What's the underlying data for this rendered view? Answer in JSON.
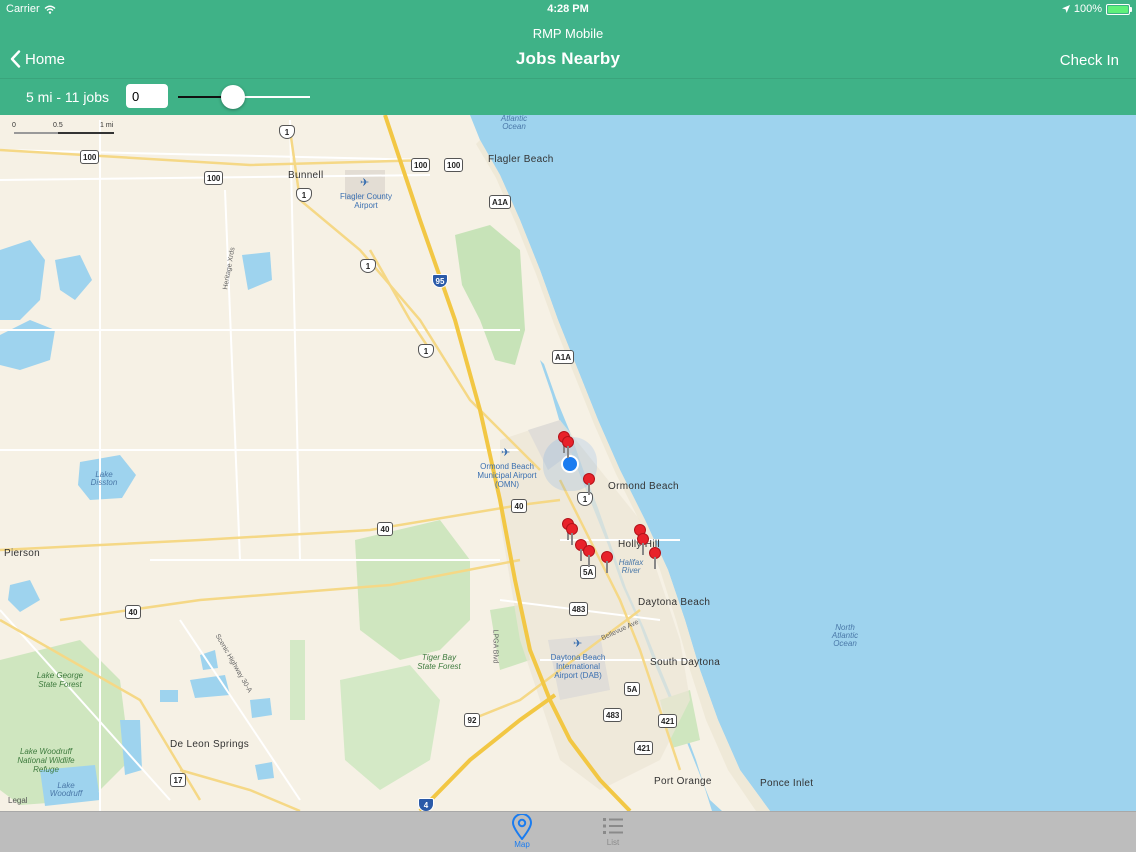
{
  "status_bar": {
    "carrier": "Carrier",
    "time": "4:28 PM",
    "battery": "100%",
    "battery_level": 1.0
  },
  "nav": {
    "subtitle": "RMP Mobile",
    "title": "Jobs Nearby",
    "back_label": "Home",
    "right_label": "Check In"
  },
  "filter": {
    "range_label": "5 mi - 11 jobs",
    "count_value": "0",
    "slider_value": 0.4
  },
  "map": {
    "scale": {
      "zero": "0",
      "half": "0.5",
      "one": "1 mi"
    },
    "cities": {
      "bunnell": "Bunnell",
      "flagler_beach": "Flagler Beach",
      "ormond_beach": "Ormond Beach",
      "holly_hill": "Holly Hill",
      "daytona_beach": "Daytona Beach",
      "south_daytona": "South Daytona",
      "port_orange": "Port Orange",
      "ponce_inlet": "Ponce Inlet",
      "pierson": "Pierson",
      "de_leon_springs": "De Leon Springs"
    },
    "water": {
      "atlantic_ocean_top": "Atlantic Ocean",
      "north_atlantic": "North Atlantic Ocean",
      "lake_disston": "Lake Disston",
      "lake_woodruff": "Lake Woodruff",
      "halifax_river": "Halifax River"
    },
    "parks": {
      "lake_george": "Lake George State Forest",
      "tiger_bay": "Tiger Bay State Forest",
      "woodruff_refuge": "Lake Woodruff National Wildlife Refuge"
    },
    "airports": {
      "flagler": "Flagler County Airport",
      "ormond": "Ormond Beach Municipal Airport (OMN)",
      "daytona": "Daytona Beach International Airport (DAB)"
    },
    "roads": {
      "heritage": "Heritage Xrds",
      "scenic": "Scenic Highway 30-A",
      "bellevue": "Bellevue Ave",
      "lpga": "LPGA Blvd"
    },
    "shields": {
      "us1": "1",
      "sr100": "100",
      "a1a": "A1A",
      "i95": "95",
      "sr40": "40",
      "sr5a": "5A",
      "sr483": "483",
      "sr421": "421",
      "sr92": "92",
      "sr17": "17",
      "i4": "4"
    },
    "pins_count": 11,
    "legal": "Legal"
  },
  "tabs": [
    {
      "label": "Map",
      "icon": "map-pin-icon",
      "active": true
    },
    {
      "label": "List",
      "icon": "list-icon",
      "active": false
    }
  ],
  "colors": {
    "header": "#3fb287",
    "accent": "#1a7cf0",
    "pin": "#e8222a",
    "ocean": "#9ed3ee"
  }
}
